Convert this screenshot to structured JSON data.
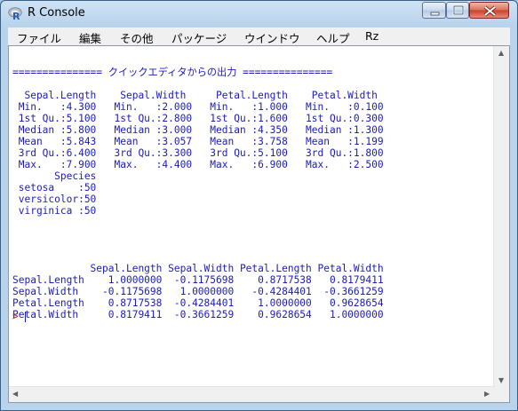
{
  "window": {
    "title": "R Console",
    "buttons": {
      "minimize": "minimize",
      "maximize": "maximize",
      "close": "close"
    }
  },
  "menu": [
    "ファイル",
    "編集",
    "その他",
    "パッケージ",
    "ウインドウ",
    "ヘルプ",
    "Rz"
  ],
  "console": {
    "lines": [
      "=============== クイックエディタからの出力 ===============",
      "",
      "  Sepal.Length    Sepal.Width     Petal.Length    Petal.Width",
      " Min.   :4.300   Min.   :2.000   Min.   :1.000   Min.   :0.100",
      " 1st Qu.:5.100   1st Qu.:2.800   1st Qu.:1.600   1st Qu.:0.300",
      " Median :5.800   Median :3.000   Median :4.350   Median :1.300",
      " Mean   :5.843   Mean   :3.057   Mean   :3.758   Mean   :1.199",
      " 3rd Qu.:6.400   3rd Qu.:3.300   3rd Qu.:5.100   3rd Qu.:1.800",
      " Max.   :7.900   Max.   :4.400   Max.   :6.900   Max.   :2.500",
      "       Species",
      " setosa    :50",
      " versicolor:50",
      " virginica :50",
      "",
      "",
      "",
      "",
      "             Sepal.Length Sepal.Width Petal.Length Petal.Width",
      "Sepal.Length    1.0000000  -0.1175698    0.8717538   0.8179411",
      "Sepal.Width    -0.1175698   1.0000000   -0.4284401  -0.3661259",
      "Petal.Length    0.8717538  -0.4284401    1.0000000   0.9628654",
      "Petal.Width     0.8179411  -0.3661259    0.9628654   1.0000000"
    ],
    "prompt": ">"
  },
  "colors": {
    "output_text": "#1c1cb4",
    "prompt": "#c8141e"
  },
  "icons": {
    "app": "r-logo-icon",
    "scroll_up": "scroll-up-icon",
    "scroll_down": "scroll-down-icon",
    "scroll_left": "scroll-left-icon",
    "scroll_right": "scroll-right-icon"
  }
}
